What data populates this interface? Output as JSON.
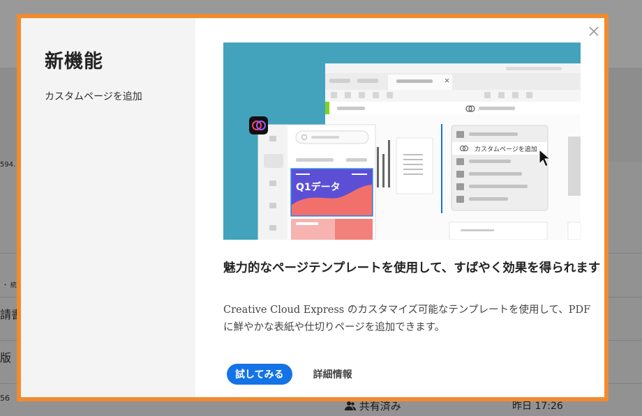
{
  "background": {
    "fragments": [
      "594.",
      "・ 統",
      "請書",
      "版",
      "56"
    ],
    "shared_label": "共有済み",
    "time_label": "昨日 17:26"
  },
  "modal": {
    "title": "新機能",
    "sidebar_items": [
      {
        "label": "カスタムページを追加"
      }
    ],
    "close_label": "閉じる",
    "illustration": {
      "context_menu_item": "カスタムページを追加",
      "card_title": "Q1データ"
    },
    "headline": "魅力的なページテンプレートを使用して、すばやく効果を得られます",
    "description": "Creative Cloud Express のカスタマイズ可能なテンプレートを使用して、PDF に鮮やかな表紙や仕切りページを追加できます。",
    "primary_button": "試してみる",
    "secondary_button": "詳細情報"
  },
  "colors": {
    "accent_orange": "#f28a2e",
    "primary_blue": "#1473e6",
    "hero_teal": "#43a3bd"
  }
}
